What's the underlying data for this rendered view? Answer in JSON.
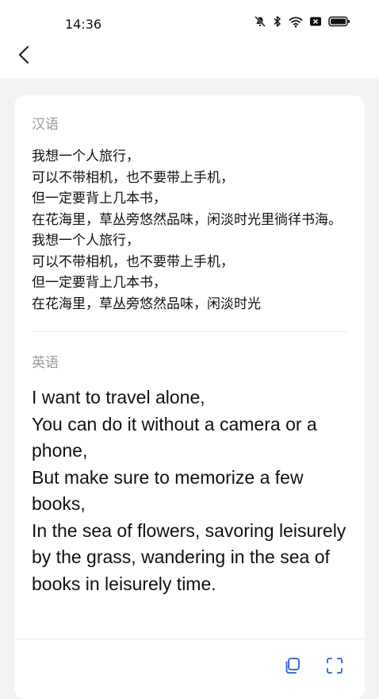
{
  "status_bar": {
    "time": "14:36",
    "icons": [
      "mute-icon",
      "bluetooth-icon",
      "wifi-icon",
      "sim-icon",
      "battery-icon"
    ]
  },
  "nav": {
    "back_icon": "chevron-left-icon"
  },
  "chinese": {
    "label": "汉语",
    "text": "我想一个人旅行，\n可以不带相机，也不要带上手机，\n但一定要背上几本书，\n在花海里，草丛旁悠然品味，闲淡时光里徜徉书海。我想一个人旅行，\n可以不带相机，也不要带上手机，\n但一定要背上几本书，\n在花海里，草丛旁悠然品味，闲淡时光"
  },
  "english": {
    "label": "英语",
    "text": "I want to travel alone,\nYou can do it without a camera or a phone,\nBut make sure to memorize a few books,\nIn the sea of flowers, savoring leisurely by the grass, wandering in the sea of books in leisurely time."
  },
  "actions": {
    "icons": [
      "copy-icon",
      "fullscreen-icon"
    ],
    "accent": "#3b6fd8"
  }
}
